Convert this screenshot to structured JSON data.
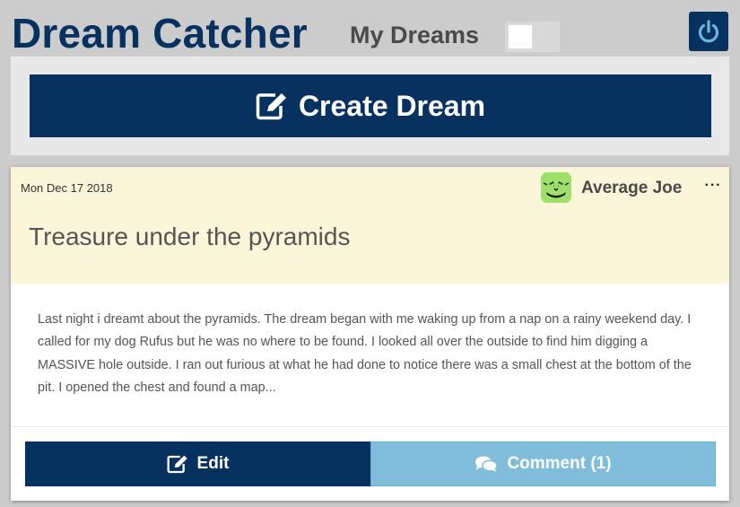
{
  "header": {
    "app_title": "Dream Catcher",
    "my_dreams_label": "My Dreams",
    "my_dreams_toggle": "off",
    "power_icon": "power-icon"
  },
  "create": {
    "label": "Create Dream",
    "icon": "edit-icon"
  },
  "dream": {
    "date": "Mon Dec 17 2018",
    "author": "Average Joe",
    "avatar_icon": "monster-avatar",
    "more_label": "···",
    "title": "Treasure under the pyramids",
    "body": "Last night i dreamt about the pyramids. The dream began with me waking up from a nap on a rainy weekend day. I called for my dog Rufus but he was no where to be found. I looked all over the outside to find him digging a MASSIVE hole outside. I ran out furious at what he had done to notice there was a small chest at the bottom of the pit. I opened the chest and found a map...",
    "edit_label": "Edit",
    "comment_label": "Comment (1)"
  },
  "colors": {
    "brand_navy": "#07315f",
    "comment_blue": "#7fbdda",
    "card_header_bg": "#fbf5d9",
    "page_bg": "#cccccc"
  }
}
